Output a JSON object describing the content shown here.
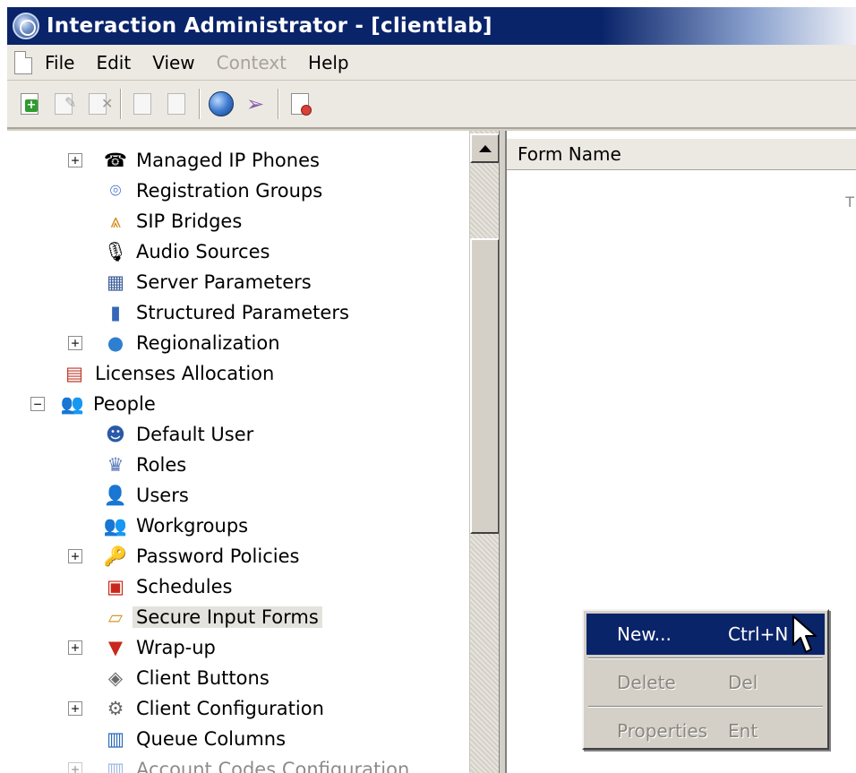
{
  "window": {
    "title": "Interaction Administrator - [clientlab]",
    "title_color": "#0a246a"
  },
  "menubar": {
    "items": [
      {
        "label": "File",
        "enabled": true
      },
      {
        "label": "Edit",
        "enabled": true
      },
      {
        "label": "View",
        "enabled": true
      },
      {
        "label": "Context",
        "enabled": false
      },
      {
        "label": "Help",
        "enabled": true
      }
    ]
  },
  "toolbar": {
    "buttons": [
      {
        "name": "new-icon"
      },
      {
        "name": "edit-icon"
      },
      {
        "name": "delete-icon"
      },
      {
        "name": "copy-icon"
      },
      {
        "name": "paste-icon"
      },
      {
        "name": "globe-icon"
      },
      {
        "name": "wand-icon"
      },
      {
        "name": "certificate-icon"
      }
    ]
  },
  "tree": {
    "items": [
      {
        "label": "Managed IP Phones",
        "expander": "+",
        "icon": "phone-icon"
      },
      {
        "label": "Registration Groups",
        "expander": "",
        "icon": "registration-icon"
      },
      {
        "label": "SIP Bridges",
        "expander": "",
        "icon": "bridge-icon"
      },
      {
        "label": "Audio Sources",
        "expander": "",
        "icon": "microphone-icon"
      },
      {
        "label": "Server Parameters",
        "expander": "",
        "icon": "server-icon"
      },
      {
        "label": "Structured Parameters",
        "expander": "",
        "icon": "database-icon"
      },
      {
        "label": "Regionalization",
        "expander": "+",
        "icon": "globe-icon"
      },
      {
        "label": "Licenses Allocation",
        "expander": "",
        "icon": "license-icon"
      },
      {
        "label": "People",
        "expander": "−",
        "icon": "people-icon"
      },
      {
        "label": "Default User",
        "expander": "",
        "icon": "default-user-icon"
      },
      {
        "label": "Roles",
        "expander": "",
        "icon": "roles-icon"
      },
      {
        "label": "Users",
        "expander": "",
        "icon": "user-icon"
      },
      {
        "label": "Workgroups",
        "expander": "",
        "icon": "workgroup-icon"
      },
      {
        "label": "Password Policies",
        "expander": "+",
        "icon": "key-icon"
      },
      {
        "label": "Schedules",
        "expander": "",
        "icon": "calendar-icon"
      },
      {
        "label": "Secure Input Forms",
        "expander": "",
        "icon": "form-icon"
      },
      {
        "label": "Wrap-up",
        "expander": "+",
        "icon": "wrapup-icon"
      },
      {
        "label": "Client Buttons",
        "expander": "",
        "icon": "button-icon"
      },
      {
        "label": "Client Configuration",
        "expander": "+",
        "icon": "config-icon"
      },
      {
        "label": "Queue Columns",
        "expander": "",
        "icon": "columns-icon"
      },
      {
        "label": "Account Codes Configuration",
        "expander": "+",
        "icon": "account-codes-icon"
      }
    ],
    "selected": "Secure Input Forms"
  },
  "list": {
    "columns": [
      "Form Name"
    ],
    "partial_text": "T"
  },
  "context_menu": {
    "items": [
      {
        "label": "New...",
        "shortcut": "Ctrl+N",
        "enabled": true,
        "highlighted": true
      },
      {
        "label": "Delete",
        "shortcut": "Del",
        "enabled": false,
        "highlighted": false
      },
      {
        "label": "Properties",
        "shortcut": "Ent",
        "enabled": false,
        "highlighted": false
      }
    ],
    "highlight_color": "#0a246a"
  }
}
